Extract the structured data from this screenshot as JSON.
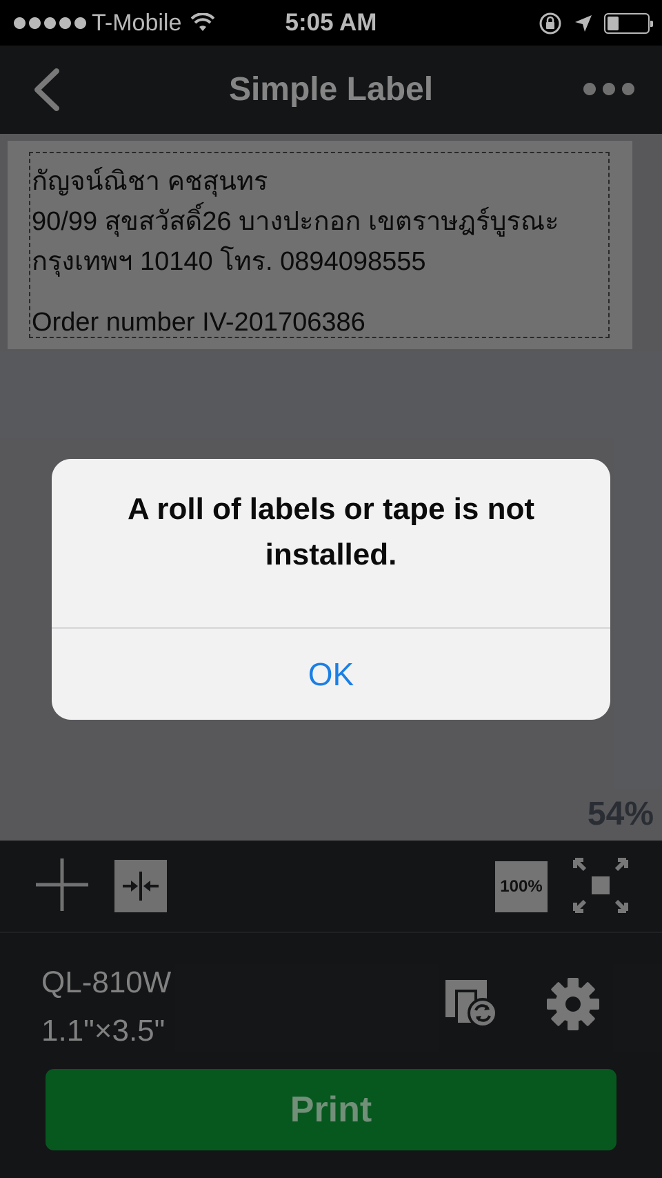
{
  "status_bar": {
    "carrier": "T-Mobile",
    "time": "5:05 AM",
    "signal_bars": 5,
    "battery_level": 0.25
  },
  "nav": {
    "title": "Simple Label",
    "back_icon": "chevron-left-icon",
    "more_icon": "more-horizontal-icon"
  },
  "label": {
    "lines": [
      "กัญจน์ณิชา คชสุนทร",
      "90/99 สุขสวัสดิ์26 บางปะกอก เขตราษฎร์บูรณะ",
      "กรุงเทพฯ 10140 โทร. 0894098555"
    ],
    "order": "Order number IV-201706386"
  },
  "zoom": "54%",
  "toolbar": {
    "add_icon": "plus-icon",
    "align_icon": "align-center-icon",
    "zoom100_label": "100%",
    "fit_icon": "fit-screen-icon"
  },
  "printer": {
    "model": "QL-810W",
    "size": "1.1\"×3.5\"",
    "switch_icon": "printer-switch-icon",
    "settings_icon": "gear-icon"
  },
  "print_button": "Print",
  "alert": {
    "message": "A roll of labels or tape is not installed.",
    "ok_label": "OK"
  },
  "colors": {
    "accent_blue": "#1b7fe4",
    "print_green": "#0a7a2a",
    "background": "#1c1e21"
  }
}
